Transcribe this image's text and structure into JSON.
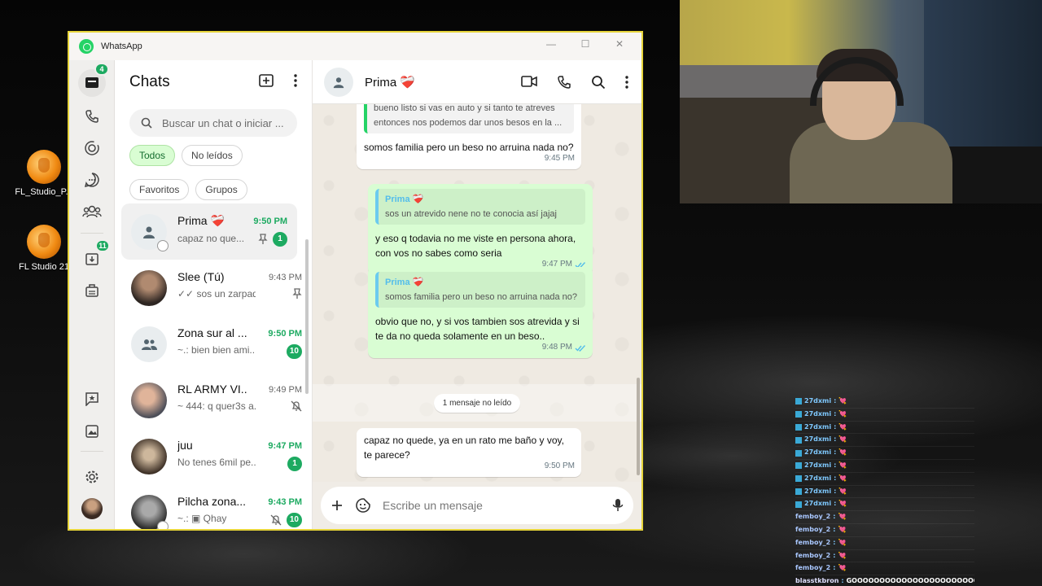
{
  "desktop": {
    "icons": [
      {
        "label": "FL_Studio_P..."
      },
      {
        "label": "FL Studio 21"
      }
    ]
  },
  "stream_chat": {
    "lines": [
      {
        "user": "27dxmi",
        "msg": "💘"
      },
      {
        "user": "27dxmi",
        "msg": "💘"
      },
      {
        "user": "27dxmi",
        "msg": "💘"
      },
      {
        "user": "27dxmi",
        "msg": "💘"
      },
      {
        "user": "27dxmi",
        "msg": "💘"
      },
      {
        "user": "27dxmi",
        "msg": "💘"
      },
      {
        "user": "27dxmi",
        "msg": "💘"
      },
      {
        "user": "27dxmi",
        "msg": "💘"
      },
      {
        "user": "27dxmi",
        "msg": "💘"
      },
      {
        "user": "femboy_2",
        "msg": "💘"
      },
      {
        "user": "femboy_2",
        "msg": "💘"
      },
      {
        "user": "femboy_2",
        "msg": "💘"
      },
      {
        "user": "femboy_2",
        "msg": "💘"
      },
      {
        "user": "femboy_2",
        "msg": "💘"
      },
      {
        "user": "blasstkbron",
        "msg": "GOOOOOOOOOOOOOOOOOOOOOOOOL"
      }
    ]
  },
  "window": {
    "title": "WhatsApp",
    "controls": {
      "minimize": "—",
      "maximize": "☐",
      "close": "✕"
    }
  },
  "rail": {
    "chats_badge": "4",
    "archived_badge": "11"
  },
  "chatlist": {
    "title": "Chats",
    "search_placeholder": "Buscar un chat o iniciar ...",
    "filters": [
      "Todos",
      "No leídos",
      "Favoritos",
      "Grupos"
    ],
    "items": [
      {
        "name": "Prima ❤️‍🩹",
        "time": "9:50 PM",
        "preview": "capaz no que...",
        "unread": "1",
        "pinned": true
      },
      {
        "name": "Slee (Tú)",
        "time": "9:43 PM",
        "preview": "✓✓ sos un zarpad...",
        "unread": "",
        "pinned": true
      },
      {
        "name": "Zona sur al ...",
        "time": "9:50 PM",
        "preview": "~.: bien bien ami...",
        "unread": "10"
      },
      {
        "name": "RL ARMY VI...",
        "time": "9:49 PM",
        "preview": "~ 444: q quer3s a...",
        "unread": "",
        "muted": true
      },
      {
        "name": "juu",
        "time": "9:47 PM",
        "preview": "No tenes 6mil pe...",
        "unread": "1"
      },
      {
        "name": "Pilcha zona...",
        "time": "9:43 PM",
        "preview": "~.: ▣ Qhay",
        "unread": "10",
        "muted": true
      }
    ]
  },
  "conversation": {
    "contact": "Prima ❤️‍🩹",
    "messages": {
      "m1_quote_text": "bueno listo si vas en auto y si tanto te atreves entonces nos podemos dar unos besos en la ...",
      "m1_text": "somos familia pero un beso no arruina nada no?",
      "m1_time": "9:45 PM",
      "m2_quote_name": "Prima ❤️‍🩹",
      "m2_quote_text": "sos un atrevido nene no te conocia así jajaj",
      "m2_text": "y eso q todavia no me viste en persona ahora, con vos no sabes como seria",
      "m2_time": "9:47 PM",
      "m3_quote_name": "Prima ❤️‍🩹",
      "m3_quote_text": "somos familia pero un beso no arruina nada no?",
      "m3_text": "obvio que no, y si vos tambien sos atrevida y si te da no queda solamente en un beso..",
      "m3_time": "9:48 PM",
      "unread_label": "1 mensaje no leído",
      "m4_text": "capaz no quede, ya en un rato me baño y voy, te parece?",
      "m4_time": "9:50 PM"
    },
    "composer_placeholder": "Escribe un mensaje"
  },
  "colors": {
    "accent": "#1daa61",
    "outgoing_bubble": "#d9fdd3",
    "window_border": "#e6d43a"
  }
}
